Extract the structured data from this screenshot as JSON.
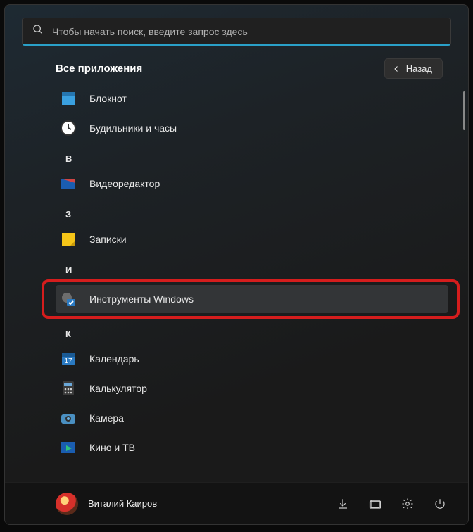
{
  "search": {
    "placeholder": "Чтобы начать поиск, введите запрос здесь"
  },
  "header": {
    "title": "Все приложения",
    "back_label": "Назад"
  },
  "letters": {
    "v": "В",
    "z": "З",
    "i": "И",
    "k": "К"
  },
  "apps": {
    "notepad": "Блокнот",
    "alarms": "Будильники и часы",
    "videoeditor": "Видеоредактор",
    "stickynotes": "Записки",
    "wintools": "Инструменты Windows",
    "calendar": "Календарь",
    "calculator": "Калькулятор",
    "camera": "Камера",
    "movies": "Кино и ТВ"
  },
  "user": {
    "name": "Виталий Каиров"
  }
}
